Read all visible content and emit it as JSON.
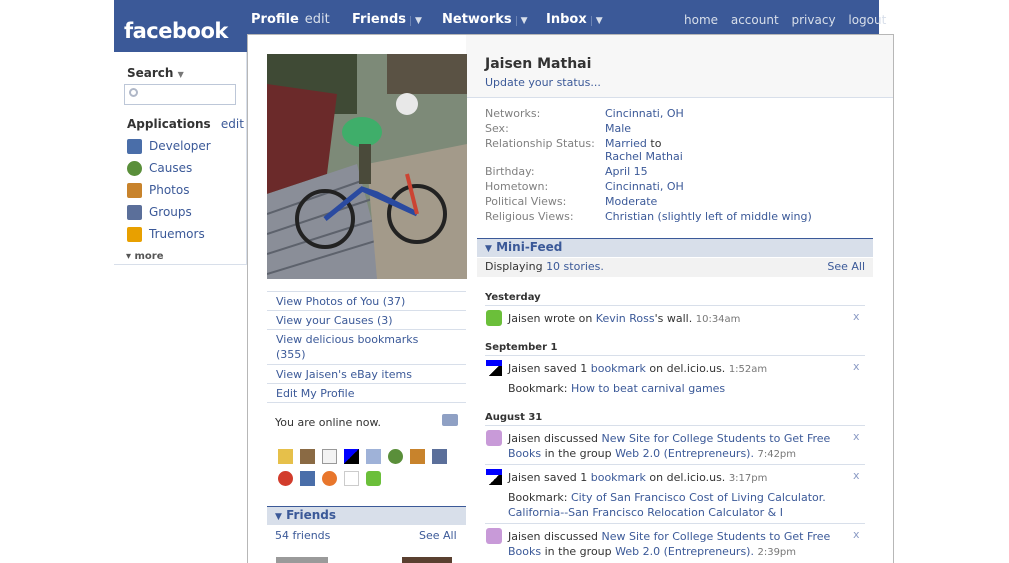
{
  "brand": "facebook",
  "nav": {
    "profile": "Profile",
    "profile_edit": "edit",
    "friends": "Friends",
    "networks": "Networks",
    "inbox": "Inbox",
    "arrow": "▼",
    "right": [
      "home",
      "account",
      "privacy",
      "logout"
    ]
  },
  "sidebar": {
    "search_label": "Search",
    "search_arrow": "▼",
    "applications_label": "Applications",
    "applications_edit": "edit",
    "apps": [
      {
        "label": "Developer",
        "icon": "developer-icon",
        "color": "#4a6ea9"
      },
      {
        "label": "Causes",
        "icon": "causes-icon",
        "color": "#5a8f3a"
      },
      {
        "label": "Photos",
        "icon": "photos-icon",
        "color": "#c8832c"
      },
      {
        "label": "Groups",
        "icon": "groups-icon",
        "color": "#5b6f9a"
      },
      {
        "label": "Truemors",
        "icon": "truemors-icon",
        "color": "#e8a000"
      }
    ],
    "more": "▾ more"
  },
  "profile": {
    "name": "Jaisen Mathai",
    "status_link": "Update your status...",
    "info": [
      {
        "label": "Networks:",
        "values": [
          "Cincinnati, OH"
        ]
      },
      {
        "label": "Sex:",
        "values": [
          "Male"
        ]
      },
      {
        "label": "Relationship Status:",
        "values": [
          "Married",
          "to",
          "Rachel Mathai"
        ]
      },
      {
        "label": "Birthday:",
        "values": [
          "April 15"
        ]
      },
      {
        "label": "Hometown:",
        "values": [
          "Cincinnati, OH"
        ]
      },
      {
        "label": "Political Views:",
        "values": [
          "Moderate"
        ]
      },
      {
        "label": "Religious Views:",
        "values": [
          "Christian (slightly left of middle wing)"
        ]
      }
    ]
  },
  "left_links": [
    "View Photos of You (37)",
    "View your Causes (3)",
    "View delicious bookmarks",
    "(355)",
    "View Jaisen's eBay items",
    "Edit My Profile"
  ],
  "online_text": "You are online now.",
  "friends_box": {
    "title": "Friends",
    "count": "54 friends",
    "see_all": "See All"
  },
  "minifeed": {
    "title": "Mini-Feed",
    "displaying": "Displaying",
    "count_link": "10 stories.",
    "see_all": "See All",
    "dates": [
      "Yesterday",
      "September 1",
      "August 31"
    ],
    "stories": {
      "s1": {
        "a": "Jaisen wrote on",
        "link": "Kevin Ross",
        "b": "'s wall.",
        "time": "10:34am"
      },
      "s2": {
        "a": "Jaisen saved 1",
        "link": "bookmark",
        "b": "on del.icio.us.",
        "time": "1:52am",
        "bm_label": "Bookmark:",
        "bm_link": "How to beat carnival games"
      },
      "s3": {
        "a": "Jaisen discussed",
        "link": "New Site for College Students to Get Free Books",
        "b": "in the group",
        "link2": "Web 2.0 (Entrepreneurs).",
        "time": "7:42pm"
      },
      "s4": {
        "a": "Jaisen saved 1",
        "link": "bookmark",
        "b": "on del.icio.us.",
        "time": "3:17pm",
        "bm_label": "Bookmark:",
        "bm_link": "City of San Francisco Cost of Living Calculator. California--San Francisco Relocation Calculator & I"
      },
      "s5": {
        "a": "Jaisen discussed",
        "link": "New Site for College Students to Get Free Books",
        "b": "in the group",
        "link2": "Web 2.0 (Entrepreneurs).",
        "time": "2:39pm"
      }
    },
    "remove": "x"
  },
  "colors": {
    "brand": "#3b5998",
    "link": "#3b5998"
  }
}
